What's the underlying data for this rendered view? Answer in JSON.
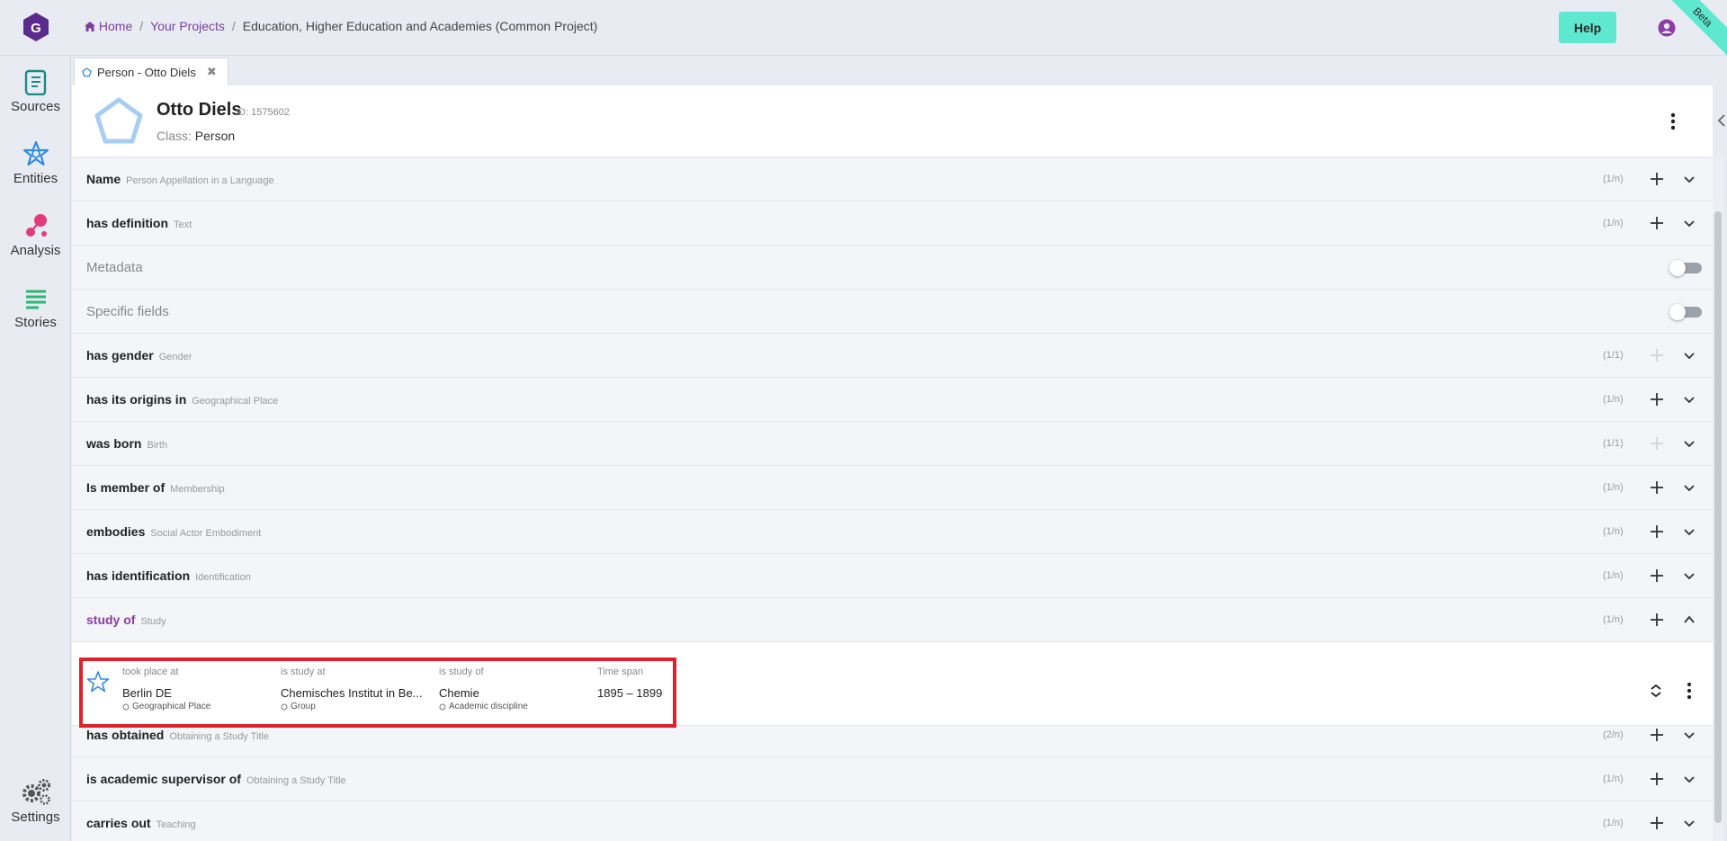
{
  "topbar": {
    "logo_letter": "G",
    "breadcrumb": [
      {
        "label": "Home",
        "icon": "home-icon"
      },
      {
        "label": "Your Projects"
      },
      {
        "label": "Education, Higher Education and Academies (Common Project)"
      }
    ],
    "help_label": "Help",
    "beta_label": "Beta"
  },
  "sidebar": {
    "items": [
      {
        "label": "Sources",
        "icon": "sources-icon",
        "color": "#1b8a8a"
      },
      {
        "label": "Entities",
        "icon": "entities-icon",
        "color": "#2f8be6"
      },
      {
        "label": "Analysis",
        "icon": "analysis-icon",
        "color": "#e23a7a"
      },
      {
        "label": "Stories",
        "icon": "stories-icon",
        "color": "#2bb673"
      },
      {
        "label": "Settings",
        "icon": "settings-icon",
        "color": "#555555"
      }
    ]
  },
  "tab": {
    "label": "Person - Otto Diels",
    "close_glyph": "✖"
  },
  "entity": {
    "name": "Otto Diels",
    "id_label": "ID: 1575602",
    "class_prefix": "Class:",
    "class_value": "Person"
  },
  "rows": [
    {
      "label": "Name",
      "sub": "Person Appellation in a Language",
      "card": "(1/n)",
      "kind": "field"
    },
    {
      "label": "has definition",
      "sub": "Text",
      "card": "(1/n)",
      "kind": "field"
    },
    {
      "label": "Metadata",
      "kind": "section"
    },
    {
      "label": "Specific fields",
      "kind": "section"
    },
    {
      "label": "has gender",
      "sub": "Gender",
      "card": "(1/1)",
      "kind": "field",
      "disabled": true
    },
    {
      "label": "has its origins in",
      "sub": "Geographical Place",
      "card": "(1/n)",
      "kind": "field"
    },
    {
      "label": "was born",
      "sub": "Birth",
      "card": "(1/1)",
      "kind": "field",
      "disabled": true
    },
    {
      "label": "Is member of",
      "sub": "Membership",
      "card": "(1/n)",
      "kind": "field"
    },
    {
      "label": "embodies",
      "sub": "Social Actor Embodiment",
      "card": "(1/n)",
      "kind": "field"
    },
    {
      "label": "has identification",
      "sub": "Identification",
      "card": "(1/n)",
      "kind": "field"
    },
    {
      "label": "study of",
      "sub": "Study",
      "card": "(1/n)",
      "kind": "field",
      "expanded": true
    },
    {
      "label": "has obtained",
      "sub": "Obtaining a Study Title",
      "card": "(2/n)",
      "kind": "field"
    },
    {
      "label": "is academic supervisor of",
      "sub": "Obtaining a Study Title",
      "card": "(1/n)",
      "kind": "field"
    },
    {
      "label": "carries out",
      "sub": "Teaching",
      "card": "(1/n)",
      "kind": "field"
    }
  ],
  "statement": {
    "columns": [
      {
        "head": "took place at",
        "value": "Berlin DE",
        "class": "Geographical Place"
      },
      {
        "head": "is study at",
        "value": "Chemisches Institut in Be...",
        "class": "Group"
      },
      {
        "head": "is study of",
        "value": "Chemie",
        "class": "Academic discipline"
      },
      {
        "head": "Time span",
        "value": "1895 – 1899",
        "class": ""
      }
    ],
    "highlight_color": "#e0212b"
  },
  "colors": {
    "accent_purple": "#8e3aa7",
    "teal": "#5ee8cf",
    "entity_blue": "#a8cdf5"
  }
}
